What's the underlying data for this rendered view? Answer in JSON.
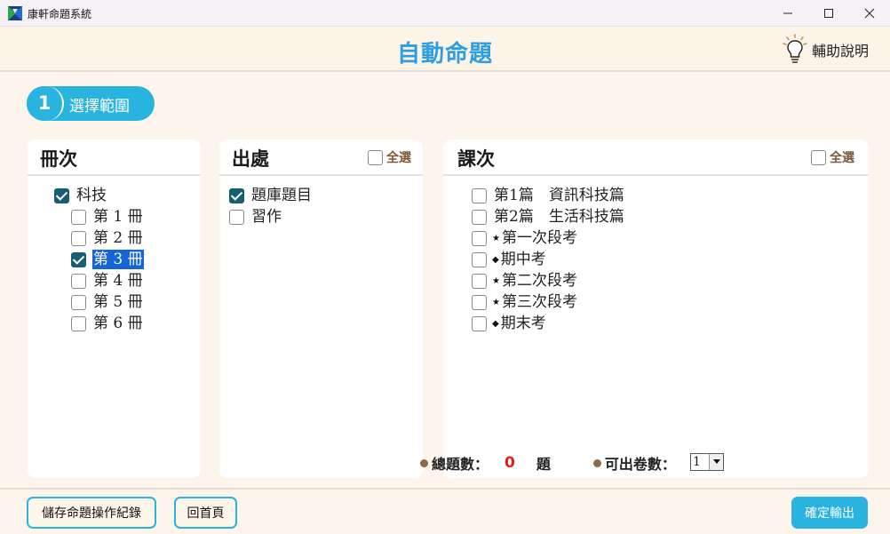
{
  "window": {
    "title": "康軒命題系統"
  },
  "header": {
    "title": "自動命題",
    "help_label": "輔助說明"
  },
  "step": {
    "number": "1",
    "label": "選擇範圍"
  },
  "volumes": {
    "title": "冊次",
    "root": {
      "label": "科技",
      "checked": true
    },
    "items": [
      {
        "label": "第 1 冊",
        "checked": false
      },
      {
        "label": "第 2 冊",
        "checked": false
      },
      {
        "label": "第 3 冊",
        "checked": true,
        "highlighted": true
      },
      {
        "label": "第 4 冊",
        "checked": false
      },
      {
        "label": "第 5 冊",
        "checked": false
      },
      {
        "label": "第 6 冊",
        "checked": false
      }
    ]
  },
  "sources": {
    "title": "出處",
    "select_all": "全選",
    "items": [
      {
        "label": "題庫題目",
        "checked": true
      },
      {
        "label": "習作",
        "checked": false
      }
    ]
  },
  "lessons": {
    "title": "課次",
    "select_all": "全選",
    "items": [
      {
        "label": "第1篇　資訊科技篇",
        "mark": "",
        "checked": false
      },
      {
        "label": "第2篇　生活科技篇",
        "mark": "",
        "checked": false
      },
      {
        "label": "第一次段考",
        "mark": "★",
        "checked": false
      },
      {
        "label": "期中考",
        "mark": "◆",
        "checked": false
      },
      {
        "label": "第二次段考",
        "mark": "★",
        "checked": false
      },
      {
        "label": "第三次段考",
        "mark": "★",
        "checked": false
      },
      {
        "label": "期末考",
        "mark": "◆",
        "checked": false
      }
    ]
  },
  "summary": {
    "total_label": "總題數：",
    "total_count": "0",
    "unit": "題",
    "papers_label": "可出卷數：",
    "papers_value": "1"
  },
  "footer": {
    "save_log_label": "儲存命題操作紀錄",
    "home_label": "回首頁",
    "confirm_label": "確定輸出"
  },
  "colors": {
    "accent": "#29b4e0",
    "title_blue": "#2f9ee0",
    "checkbox_checked": "#165f72",
    "count_red": "#e02020",
    "background": "#fdf5ec"
  }
}
